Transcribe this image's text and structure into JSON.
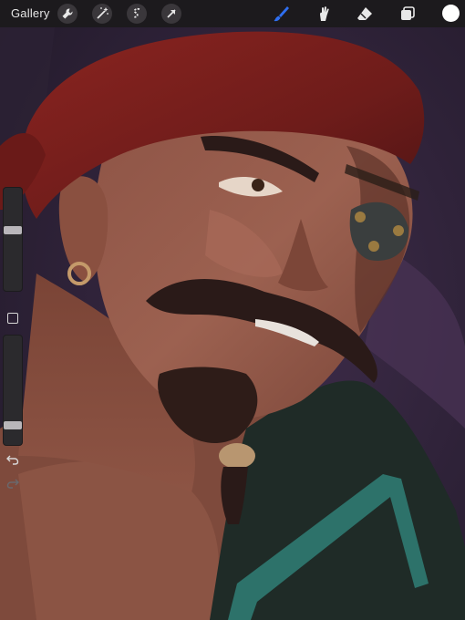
{
  "app": {
    "gallery_label": "Gallery"
  },
  "toolbar": {
    "left_icons": [
      "wrench-icon",
      "magic-wand-icon",
      "selection-icon",
      "transform-arrow-icon"
    ],
    "right_icons": [
      "brush-icon",
      "smudge-icon",
      "eraser-icon",
      "layers-icon"
    ],
    "active_tool": "brush-icon",
    "active_tool_color": "#2f6ff0",
    "current_color": "#ffffff"
  },
  "sidebar": {
    "brush_size_level": 0.6,
    "opacity_level": 0.15,
    "icons": [
      "modifier-square-icon",
      "undo-icon",
      "redo-icon"
    ]
  },
  "colors": {
    "topbar": "#1c1a1d",
    "bandana": "#7c1f1f",
    "skin": "#9a5a4c",
    "background": "#3a2a44",
    "hair": "#2a1a18",
    "jacket": "#1e2a26",
    "strap": "#2f7a72"
  }
}
